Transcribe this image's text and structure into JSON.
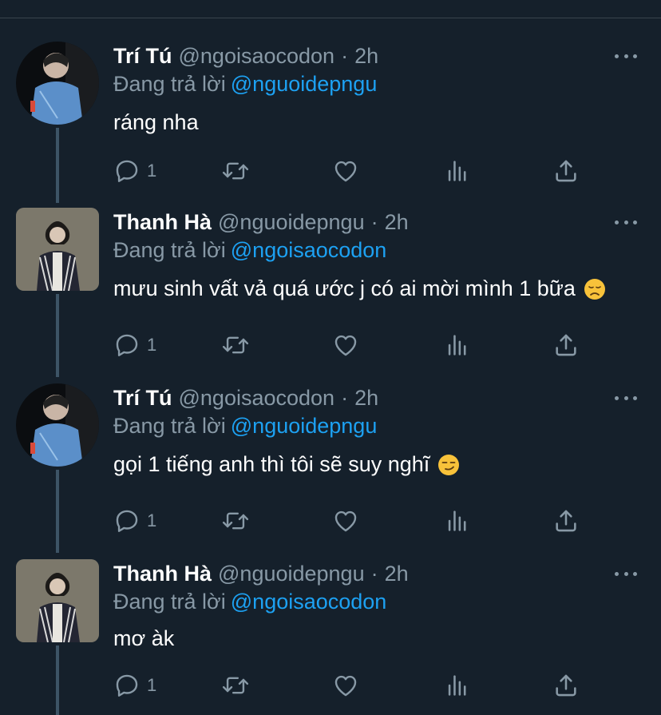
{
  "tweets": [
    {
      "name": "Trí Tú",
      "handle": "@ngoisaocodon",
      "dot": "·",
      "time": "2h",
      "replying_prefix": "Đang trả lời",
      "replying_to": "@nguoidepngu",
      "text": "ráng nha",
      "emoji": "",
      "reply_count": "1",
      "avatar": "tri-tu-avatar"
    },
    {
      "name": "Thanh Hà",
      "handle": "@nguoidepngu",
      "dot": "·",
      "time": "2h",
      "replying_prefix": "Đang trả lời",
      "replying_to": "@ngoisaocodon",
      "text": "mưu sinh vất vả quá ước j có ai mời mình 1 bữa",
      "emoji": "disappointed-face-emoji",
      "reply_count": "1",
      "avatar": "thanh-ha-avatar"
    },
    {
      "name": "Trí Tú",
      "handle": "@ngoisaocodon",
      "dot": "·",
      "time": "2h",
      "replying_prefix": "Đang trả lời",
      "replying_to": "@nguoidepngu",
      "text": "gọi 1 tiếng anh thì tôi sẽ suy nghĩ",
      "emoji": "smirking-face-emoji",
      "reply_count": "1",
      "avatar": "tri-tu-avatar"
    },
    {
      "name": "Thanh Hà",
      "handle": "@nguoidepngu",
      "dot": "·",
      "time": "2h",
      "replying_prefix": "Đang trả lời",
      "replying_to": "@ngoisaocodon",
      "text": "mơ àk",
      "emoji": "",
      "reply_count": "1",
      "avatar": "thanh-ha-avatar"
    }
  ],
  "icons": {
    "reply": "reply-icon",
    "retweet": "retweet-icon",
    "like": "heart-icon",
    "stats": "analytics-icon",
    "share": "share-icon",
    "more": "more-icon"
  },
  "colors": {
    "background": "#15202b",
    "text": "#ffffff",
    "muted": "#8899a6",
    "accent": "#1da1f2",
    "divider": "#38444d",
    "thread_line": "#3d5466"
  }
}
